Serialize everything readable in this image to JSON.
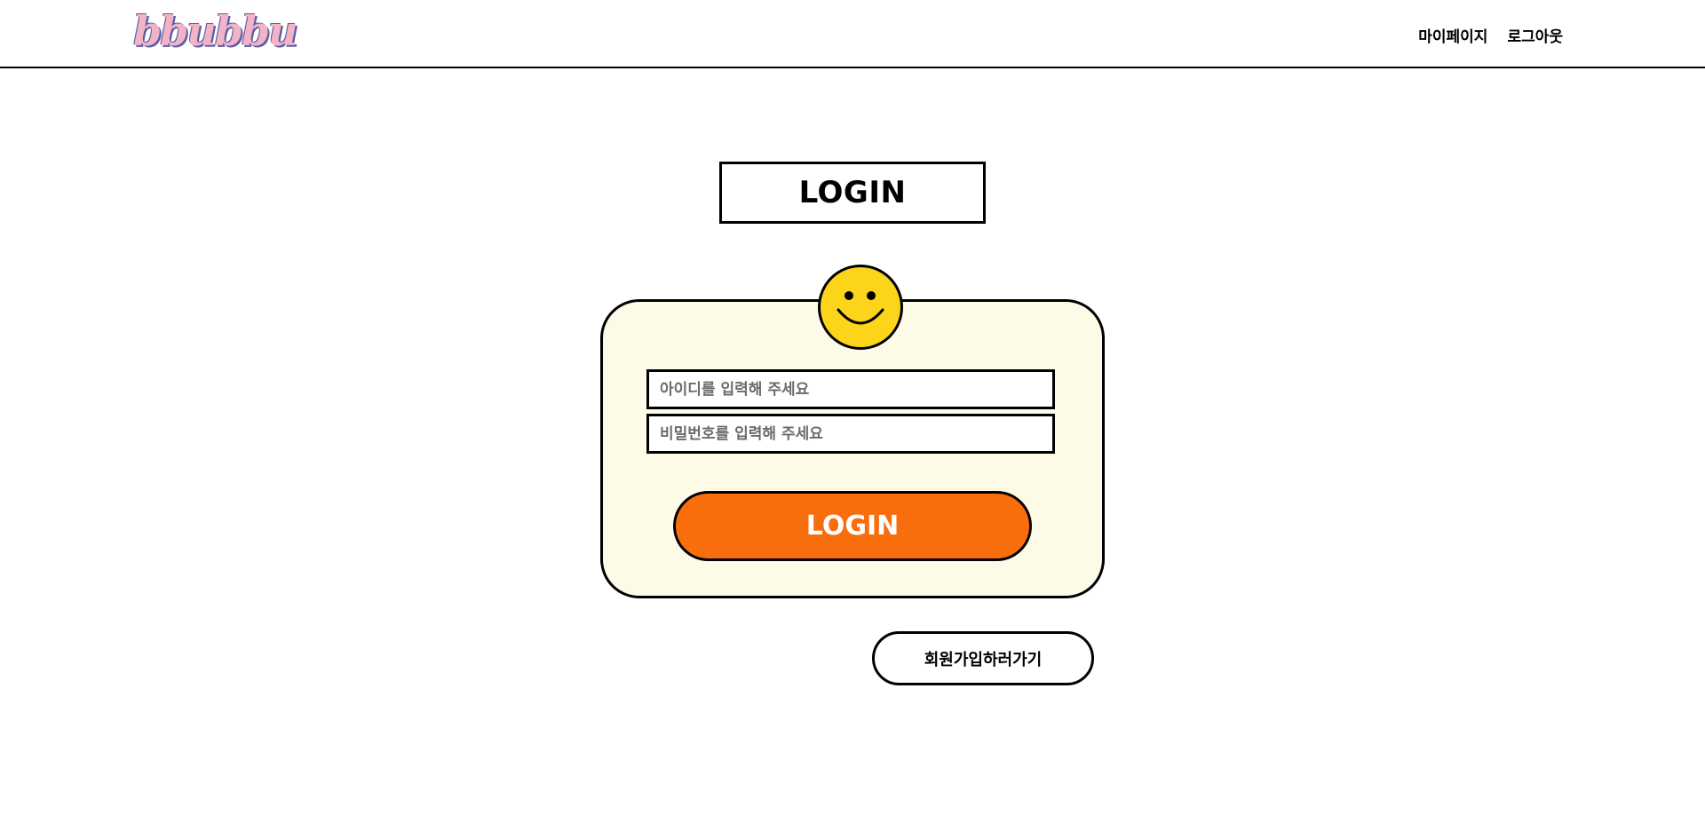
{
  "header": {
    "logo_text": "bbubbu",
    "nav": {
      "mypage_label": "마이페이지",
      "logout_label": "로그아웃"
    }
  },
  "main": {
    "title": "LOGIN",
    "form": {
      "id_placeholder": "아이디를 입력해 주세요",
      "password_placeholder": "비밀번호를 입력해 주세요",
      "submit_label": "LOGIN"
    },
    "signup_label": "회원가입하러가기"
  },
  "colors": {
    "accent_orange": "#f86d0c",
    "card_background": "#fdfae8",
    "smiley_yellow": "#fcd51a",
    "logo_pink": "#f3b3c6",
    "logo_outline": "#5b5ea6"
  },
  "icons": {
    "mascot": "smiley-face-icon"
  }
}
